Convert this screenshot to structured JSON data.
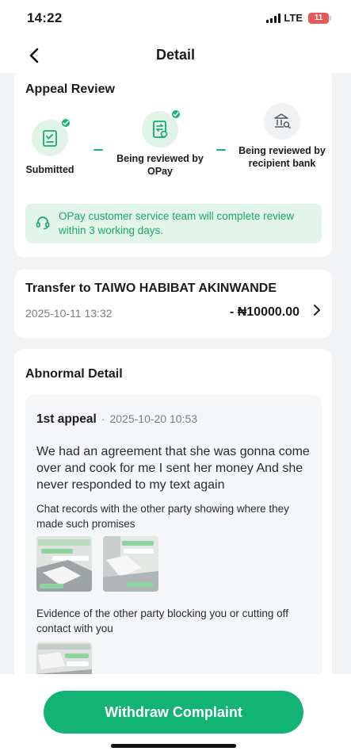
{
  "status_bar": {
    "time": "14:22",
    "network": "LTE",
    "battery": "11"
  },
  "nav": {
    "title": "Detail"
  },
  "appeal_review": {
    "title": "Appeal Review",
    "steps": [
      {
        "label": "Submitted",
        "state": "done",
        "icon": "checklist-icon"
      },
      {
        "label": "Being reviewed by OPay",
        "state": "done",
        "icon": "document-transfer-icon"
      },
      {
        "label": "Being reviewed by recipient bank",
        "state": "pending",
        "icon": "bank-search-icon"
      }
    ],
    "notice": "OPay customer service team will complete review within 3 working days.",
    "notice_icon": "headset-icon"
  },
  "transfer": {
    "title": "Transfer to TAIWO HABIBAT AKINWANDE",
    "date": "2025-10-11 13:32",
    "amount": "- ₦10000.00"
  },
  "abnormal_detail": {
    "title": "Abnormal Detail",
    "appeal_number": "1st appeal",
    "separator": "·",
    "appeal_date": "2025-10-20 10:53",
    "reason": "We had an agreement that she was gonna come over and cook for me I sent her money And she never responded to my text again",
    "evidence_1_label": "Chat records with the other party showing where they made such promises",
    "evidence_1_count": 2,
    "evidence_2_label": "Evidence of the other party blocking you or cutting off contact with you",
    "evidence_2_count": 1
  },
  "footer": {
    "withdraw_label": "Withdraw Complaint"
  },
  "colors": {
    "accent": "#13b373",
    "notice_bg": "#e3f5ea",
    "notice_text": "#19a865",
    "page_bg": "#f2f3f5"
  }
}
